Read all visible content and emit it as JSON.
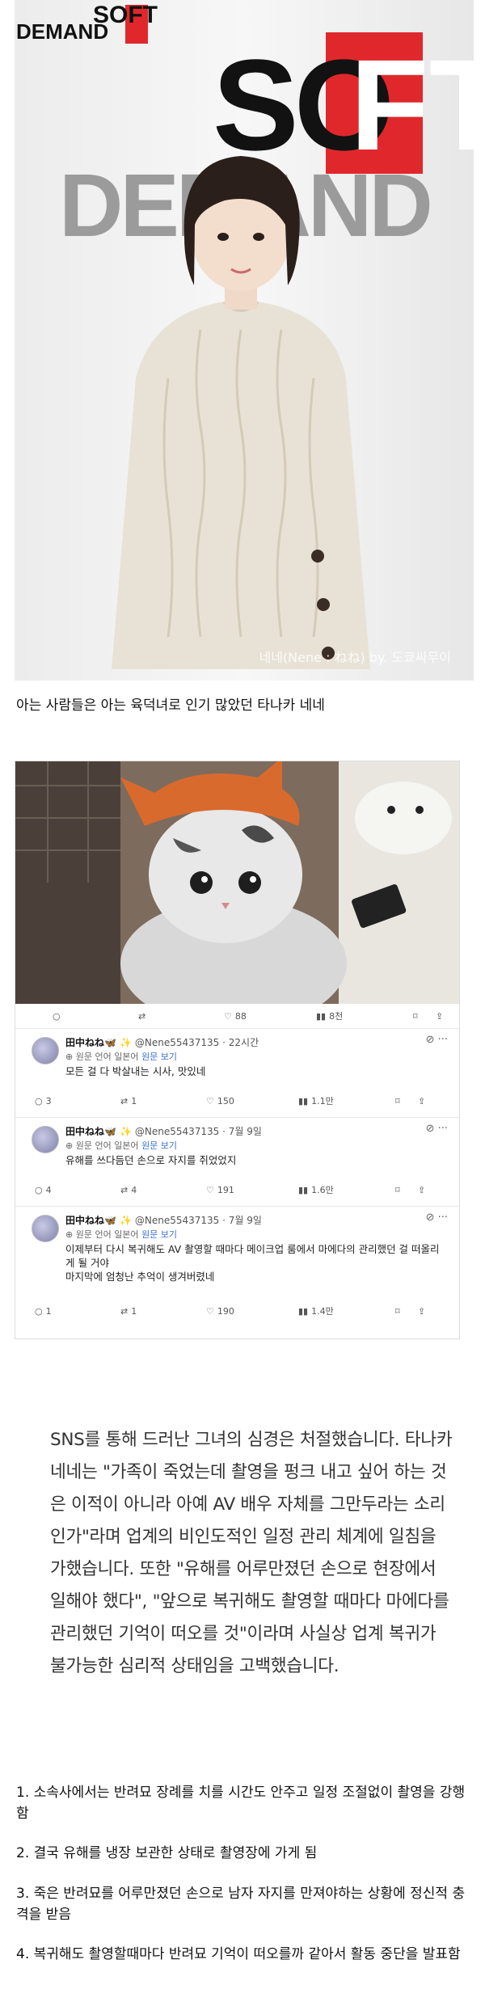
{
  "hero": {
    "logo_top": "SOFT",
    "logo_bottom": "DEMAND",
    "credit": "네네(Nene : ねね) by. 도쿄싸무이"
  },
  "caption": "아는 사람들은 아는 육덕녀로 인기 많았던 타나카 네네",
  "tweets": {
    "top_actions": {
      "views": "88",
      "stats": "8천"
    },
    "items": [
      {
        "name": "田中ねね🦋 ✨",
        "handle": "@Nene55437135 · 22시간",
        "trans_prefix": "원문 언어 일본어",
        "trans_link": "원문 보기",
        "body": "모든 걸 다 박살내는 시사, 맛있네",
        "replies": "3",
        "retweets": "1",
        "likes": "150",
        "views": "1.1만"
      },
      {
        "name": "田中ねね🦋 ✨",
        "handle": "@Nene55437135 · 7월 9일",
        "trans_prefix": "원문 언어 일본어",
        "trans_link": "원문 보기",
        "body": "유해를 쓰다듬던 손으로 자지를 쥐었었지",
        "replies": "4",
        "retweets": "4",
        "likes": "191",
        "views": "1.6만"
      },
      {
        "name": "田中ねね🦋 ✨",
        "handle": "@Nene55437135 · 7월 9일",
        "trans_prefix": "원문 언어 일본어",
        "trans_link": "원문 보기",
        "body": "이제부터 다시 복귀해도 AV 촬영할 때마다 메이크업 룸에서 마에다의 관리했던 걸 떠올리게 될 거야\n마지막에 엄청난 추억이 생겨버렸네",
        "replies": "1",
        "retweets": "1",
        "likes": "190",
        "views": "1.4만"
      }
    ]
  },
  "article": "SNS를 통해 드러난 그녀의 심경은 처절했습니다. 타나카 네네는 \"가족이 죽었는데 촬영을 펑크 내고 싶어 하는 것은 이적이 아니라 아예 AV 배우 자체를 그만두라는 소리인가\"라며 업계의 비인도적인 일정 관리 체계에 일침을 가했습니다. 또한 \"유해를 어루만졌던 손으로 현장에서 일해야 했다\", \"앞으로 복귀해도 촬영할 때마다 마에다를 관리했던 기억이 떠오를 것\"이라며 사실상 업계 복귀가 불가능한 심리적 상태임을 고백했습니다.",
  "list": [
    "1. 소속사에서는 반려묘 장례를 치를 시간도 안주고 일정 조절없이 촬영을 강행함",
    "2. 결국 유해를 냉장 보관한 상태로 촬영장에 가게 됨",
    "3. 죽은 반려묘를 어루만졌던 손으로 남자 자지를 만져야하는 상황에 정신적 충격을 받음",
    "4. 복귀해도 촬영할때마다 반려묘 기억이 떠오를까 같아서 활동 중단을 발표함"
  ]
}
